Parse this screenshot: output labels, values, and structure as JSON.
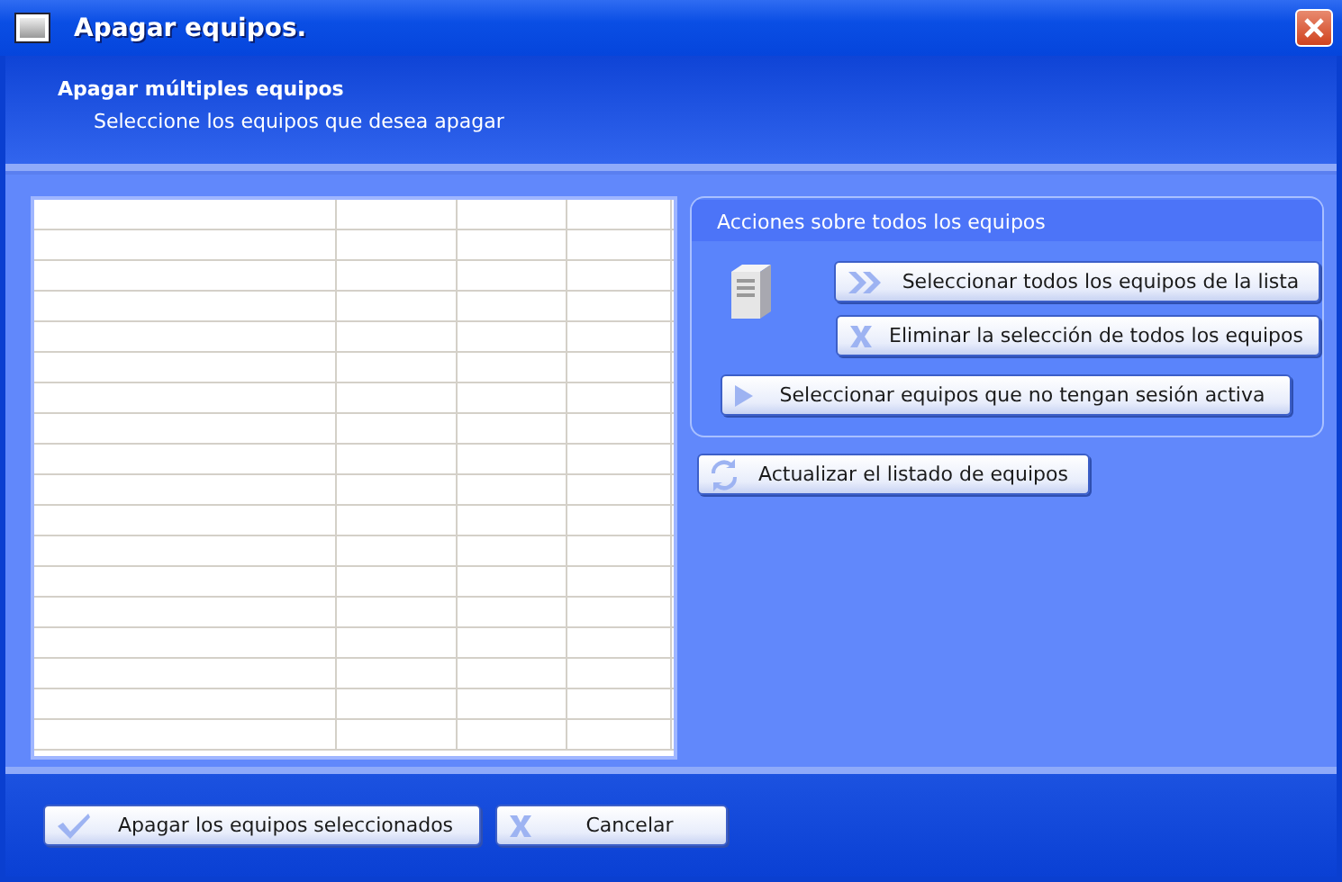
{
  "window": {
    "title": "Apagar equipos."
  },
  "header": {
    "title": "Apagar múltiples equipos",
    "subtitle": "Seleccione los equipos que desea apagar"
  },
  "group": {
    "title": "Acciones sobre todos los equipos",
    "buttons": [
      {
        "label": "Seleccionar todos los equipos de la lista",
        "kind": "chevrons"
      },
      {
        "label": "Eliminar la selección de todos los equipos",
        "kind": "cross"
      },
      {
        "label": "Seleccionar equipos que no tengan sesión activa",
        "kind": "arrow"
      }
    ]
  },
  "refresh_button": {
    "label": "Actualizar el listado de equipos",
    "kind": "refresh"
  },
  "footer_buttons": [
    {
      "label": "Apagar los equipos seleccionados",
      "kind": "check"
    },
    {
      "label": "Cancelar",
      "kind": "cross"
    }
  ]
}
